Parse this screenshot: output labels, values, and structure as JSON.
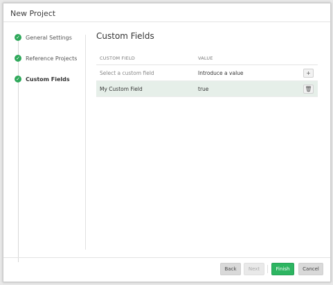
{
  "window": {
    "title": "New Project"
  },
  "wizard": {
    "steps": [
      {
        "label": "General Settings",
        "done": true
      },
      {
        "label": "Reference Projects",
        "done": true
      },
      {
        "label": "Custom Fields",
        "done": true,
        "active": true
      }
    ]
  },
  "custom_fields": {
    "title": "Custom Fields",
    "columns": [
      "CUSTOM FIELD",
      "VALUE"
    ],
    "new_row": {
      "field_placeholder": "Select a custom field",
      "value_placeholder": "Introduce a value"
    },
    "rows": [
      {
        "field": "My Custom Field",
        "value": "true"
      }
    ]
  },
  "footer": {
    "back": "Back",
    "next": "Next",
    "finish": "Finish",
    "cancel": "Cancel"
  },
  "icons": {
    "step_done": "check-circle-icon",
    "add": "plus-icon",
    "delete": "trash-icon"
  },
  "colors": {
    "accent": "#2db561",
    "selected_row": "#e6efe9"
  }
}
